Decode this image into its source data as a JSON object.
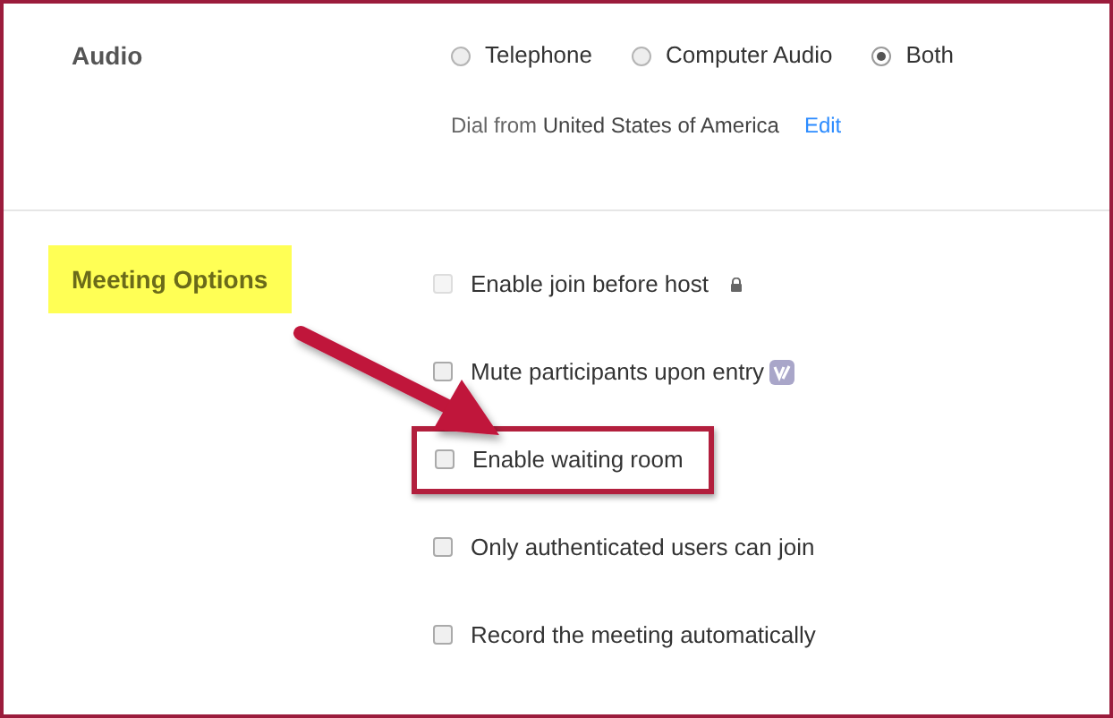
{
  "audio": {
    "label": "Audio",
    "options": [
      {
        "label": "Telephone",
        "selected": false
      },
      {
        "label": "Computer Audio",
        "selected": false
      },
      {
        "label": "Both",
        "selected": true
      }
    ],
    "dial_from": {
      "prefix": "Dial from",
      "country": "United States of America",
      "link": "Edit"
    }
  },
  "meeting_options": {
    "label": "Meeting Options",
    "highlighted": true,
    "options": [
      {
        "label": "Enable join before host",
        "checked": false,
        "disabled": true,
        "highlighted": false,
        "kind": "lock"
      },
      {
        "label": "Mute participants upon entry",
        "checked": false,
        "disabled": false,
        "highlighted": false,
        "kind": "badge"
      },
      {
        "label": "Enable waiting room",
        "checked": false,
        "disabled": false,
        "highlighted": true
      },
      {
        "label": "Only authenticated users can join",
        "checked": false,
        "disabled": false,
        "highlighted": false
      },
      {
        "label": "Record the meeting automatically",
        "checked": false,
        "disabled": false,
        "highlighted": false
      }
    ]
  }
}
